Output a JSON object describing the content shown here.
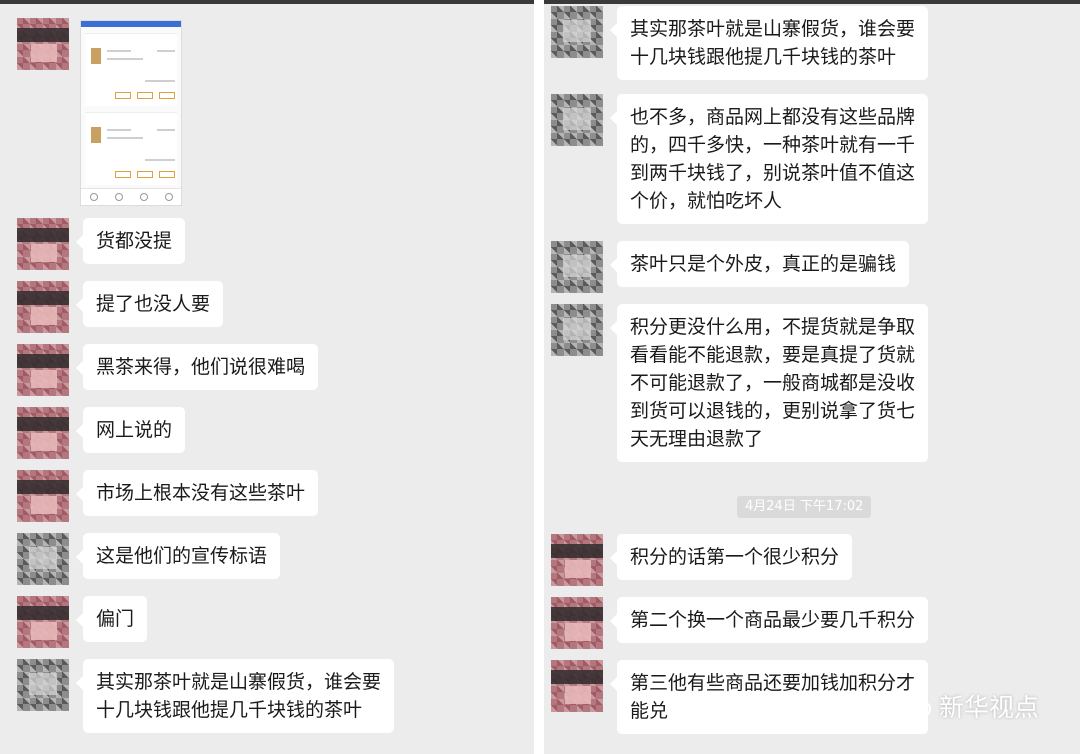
{
  "left_panel": {
    "messages": [
      {
        "avatar": "pink",
        "lines": [
          "货都没提"
        ]
      },
      {
        "avatar": "pink",
        "lines": [
          "提了也没人要"
        ]
      },
      {
        "avatar": "pink",
        "lines": [
          "黑茶来得，他们说很难喝"
        ]
      },
      {
        "avatar": "pink",
        "lines": [
          "网上说的"
        ]
      },
      {
        "avatar": "pink",
        "lines": [
          "市场上根本没有这些茶叶"
        ]
      },
      {
        "avatar": "gray",
        "lines": [
          "这是他们的宣传标语"
        ]
      },
      {
        "avatar": "pink",
        "lines": [
          "偏门"
        ]
      },
      {
        "avatar": "gray",
        "lines": [
          "其实那茶叶就是山寨假货，谁会要",
          "十几块钱跟他提几千块钱的茶叶"
        ]
      }
    ]
  },
  "right_panel": {
    "messages": [
      {
        "avatar": "gray",
        "lines": [
          "其实那茶叶就是山寨假货，谁会要",
          "十几块钱跟他提几千块钱的茶叶"
        ]
      },
      {
        "avatar": "gray",
        "lines": [
          "也不多，商品网上都没有这些品牌",
          "的，四千多快，一种茶叶就有一千",
          "到两千块钱了，别说茶叶值不值这",
          "个价，就怕吃坏人"
        ]
      },
      {
        "avatar": "gray",
        "lines": [
          "茶叶只是个外皮，真正的是骗钱"
        ]
      },
      {
        "avatar": "gray",
        "lines": [
          "积分更没什么用，不提货就是争取",
          "看看能不能退款，要是真提了货就",
          "不可能退款了，一般商城都是没收",
          "到货可以退钱的，更别说拿了货七",
          "天无理由退款了"
        ]
      },
      {
        "avatar": "pink",
        "lines": [
          "积分的话第一个很少积分"
        ]
      },
      {
        "avatar": "pink",
        "lines": [
          "第二个换一个商品最少要几千积分"
        ]
      },
      {
        "avatar": "pink",
        "lines": [
          "第三他有些商品还要加钱加积分才",
          "能兑"
        ]
      }
    ],
    "timestamp": "4月24日 下午17:02"
  },
  "watermark": {
    "text": "新华视点",
    "icon": "wechat-icon"
  }
}
